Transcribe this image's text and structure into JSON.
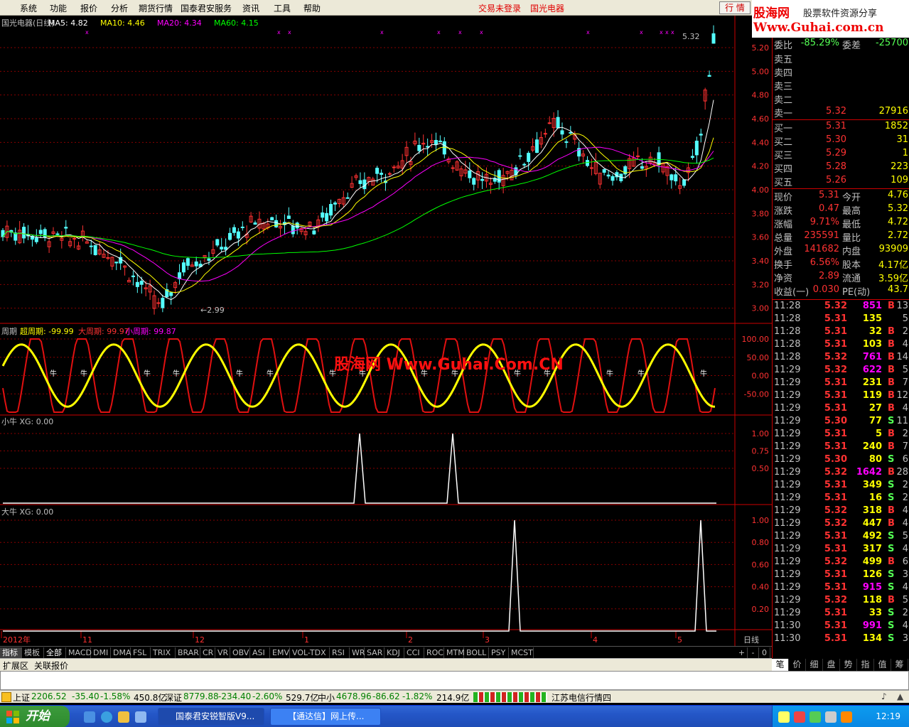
{
  "menu": {
    "items": [
      "系统",
      "功能",
      "报价",
      "分析",
      "期货行情",
      "国泰君安服务",
      "资讯",
      "工具",
      "帮助"
    ],
    "status_login": "交易未登录",
    "stock_link": "国光电器",
    "quote_button": "行 情"
  },
  "logo": {
    "top": "股海网",
    "top_sub": "股票软件资源分享",
    "bottom": "Www.Guhai.com.cn"
  },
  "chart": {
    "title": "国光电器(日线)",
    "ma5": "MA5: 4.82",
    "ma10": "MA10: 4.46",
    "ma20": "MA20: 4.34",
    "ma60": "MA60: 4.15",
    "high_label": "5.32",
    "low_label": "←2.99",
    "price_axis": [
      "5.20",
      "5.00",
      "4.80",
      "4.60",
      "4.40",
      "4.20",
      "4.00",
      "3.80",
      "3.60",
      "3.40",
      "3.20",
      "3.00"
    ],
    "cycle_title": "周期",
    "cycle_super": "超周期: -99.99",
    "cycle_big": "大周期: 99.97",
    "cycle_small": "小周期: 99.87",
    "cycle_axis": [
      "100.00",
      "50.00",
      "0.00",
      "-50.00"
    ],
    "niu_marker": "牛",
    "watermark": "股海网 Www.Guhai.Com.CN",
    "small_title": "小牛  XG: 0.00",
    "small_axis": [
      "1.00",
      "0.75",
      "0.50"
    ],
    "big_title": "大牛  XG: 0.00",
    "big_axis": [
      "1.00",
      "0.80",
      "0.60",
      "0.40",
      "0.20"
    ],
    "date_axis": [
      {
        "x": 2,
        "t": "2012年"
      },
      {
        "x": 114,
        "t": "11"
      },
      {
        "x": 272,
        "t": "12"
      },
      {
        "x": 426,
        "t": "1"
      },
      {
        "x": 572,
        "t": "2"
      },
      {
        "x": 680,
        "t": "3"
      },
      {
        "x": 832,
        "t": "4"
      },
      {
        "x": 951,
        "t": "5"
      }
    ],
    "period": "日线"
  },
  "chart_data": {
    "type": "candlestick",
    "title": "国光电器(日线)",
    "ylim": [
      2.95,
      5.35
    ],
    "high": 5.32,
    "low": 2.99,
    "ma": {
      "MA5": 4.82,
      "MA10": 4.46,
      "MA20": 4.34,
      "MA60": 4.15
    },
    "cycle": {
      "super": -99.99,
      "big": 99.97,
      "small": 99.87
    },
    "xiaoniu_xg": 0.0,
    "daniu_xg": 0.0
  },
  "panel": {
    "weibi_lbl": "委比",
    "weibi": "-85.29%",
    "weicha_lbl": "委差",
    "weicha": "-25700",
    "sells": [
      {
        "lbl": "卖五",
        "p": "",
        "v": ""
      },
      {
        "lbl": "卖四",
        "p": "",
        "v": ""
      },
      {
        "lbl": "卖三",
        "p": "",
        "v": ""
      },
      {
        "lbl": "卖二",
        "p": "",
        "v": ""
      },
      {
        "lbl": "卖一",
        "p": "5.32",
        "v": "27916"
      }
    ],
    "buys": [
      {
        "lbl": "买一",
        "p": "5.31",
        "v": "1852"
      },
      {
        "lbl": "买二",
        "p": "5.30",
        "v": "31"
      },
      {
        "lbl": "买三",
        "p": "5.29",
        "v": "1"
      },
      {
        "lbl": "买四",
        "p": "5.28",
        "v": "223"
      },
      {
        "lbl": "买五",
        "p": "5.26",
        "v": "109"
      }
    ],
    "stats": [
      {
        "l1": "现价",
        "v1": "5.31",
        "l2": "今开",
        "v2": "4.76"
      },
      {
        "l1": "涨跌",
        "v1": "0.47",
        "l2": "最高",
        "v2": "5.32"
      },
      {
        "l1": "涨幅",
        "v1": "9.71%",
        "l2": "最低",
        "v2": "4.72"
      },
      {
        "l1": "总量",
        "v1": "235591",
        "l2": "量比",
        "v2": "2.72"
      },
      {
        "l1": "外盘",
        "v1": "141682",
        "l2": "内盘",
        "v2": "93909"
      },
      {
        "l1": "换手",
        "v1": "6.56%",
        "l2": "股本",
        "v2": "4.17亿"
      },
      {
        "l1": "净资",
        "v1": "2.89",
        "l2": "流通",
        "v2": "3.59亿"
      },
      {
        "l1": "收益(一)",
        "v1": "0.030",
        "l2": "PE(动)",
        "v2": "43.7"
      }
    ],
    "ticks": [
      [
        "11:28",
        "5.32",
        "851",
        "B",
        "13"
      ],
      [
        "11:28",
        "5.31",
        "135",
        "",
        "5"
      ],
      [
        "11:28",
        "5.31",
        "32",
        "B",
        "2"
      ],
      [
        "11:28",
        "5.31",
        "103",
        "B",
        "4"
      ],
      [
        "11:28",
        "5.32",
        "761",
        "B",
        "14"
      ],
      [
        "11:29",
        "5.32",
        "622",
        "B",
        "5"
      ],
      [
        "11:29",
        "5.31",
        "231",
        "B",
        "7"
      ],
      [
        "11:29",
        "5.31",
        "119",
        "B",
        "12"
      ],
      [
        "11:29",
        "5.31",
        "27",
        "B",
        "4"
      ],
      [
        "11:29",
        "5.30",
        "77",
        "S",
        "11"
      ],
      [
        "11:29",
        "5.31",
        "5",
        "B",
        "2"
      ],
      [
        "11:29",
        "5.31",
        "240",
        "B",
        "7"
      ],
      [
        "11:29",
        "5.30",
        "80",
        "S",
        "6"
      ],
      [
        "11:29",
        "5.32",
        "1642",
        "B",
        "28"
      ],
      [
        "11:29",
        "5.31",
        "349",
        "S",
        "2"
      ],
      [
        "11:29",
        "5.31",
        "16",
        "S",
        "2"
      ],
      [
        "11:29",
        "5.32",
        "318",
        "B",
        "4"
      ],
      [
        "11:29",
        "5.32",
        "447",
        "B",
        "4"
      ],
      [
        "11:29",
        "5.31",
        "492",
        "S",
        "5"
      ],
      [
        "11:29",
        "5.31",
        "317",
        "S",
        "4"
      ],
      [
        "11:29",
        "5.32",
        "499",
        "B",
        "6"
      ],
      [
        "11:29",
        "5.31",
        "126",
        "S",
        "3"
      ],
      [
        "11:29",
        "5.31",
        "915",
        "S",
        "4"
      ],
      [
        "11:29",
        "5.32",
        "118",
        "B",
        "5"
      ],
      [
        "11:29",
        "5.31",
        "33",
        "S",
        "2"
      ],
      [
        "11:30",
        "5.31",
        "991",
        "S",
        "4"
      ],
      [
        "11:30",
        "5.31",
        "134",
        "S",
        "3"
      ]
    ]
  },
  "tabs": [
    "指标",
    "模板",
    "全部",
    "MACD",
    "DMI",
    "DMA",
    "FSL",
    "TRIX",
    "BRAR",
    "CR",
    "VR",
    "OBV",
    "ASI",
    "EMV",
    "VOL-TDX",
    "RSI",
    "WR",
    "SAR",
    "KDJ",
    "CCI",
    "ROC",
    "MTM",
    "BOLL",
    "PSY",
    "MCST"
  ],
  "tab_ctrl": [
    "+",
    "-",
    "0"
  ],
  "tabs2": [
    "扩展区",
    "关联报价"
  ],
  "rtabs": [
    "笔",
    "价",
    "细",
    "盘",
    "势",
    "指",
    "值",
    "筹"
  ],
  "status": {
    "sh_lbl": "上证",
    "sh": "2206.52",
    "sh_chg": "-35.40",
    "sh_pct": "-1.58%",
    "sh_amt": "450.8亿",
    "sz_lbl": "深证",
    "sz": "8779.88",
    "sz_chg": "-234.40",
    "sz_pct": "-2.60%",
    "sz_amt": "529.7亿",
    "zx_lbl": "中小",
    "zx": "4678.96",
    "zx_chg": "-86.62",
    "zx_pct": "-1.82%",
    "zx_amt": "214.9亿",
    "ticker": "江苏电信行情四"
  },
  "taskbar": {
    "start": "开始",
    "task1": "国泰君安锐智版V9...",
    "task2": "【通达信】网上传...",
    "clock": "12:19"
  },
  "colors": {
    "up": "#ff3232",
    "down": "#54ffff",
    "ma5": "#ffffff",
    "ma10": "#ffff00",
    "ma20": "#ff00ff",
    "ma60": "#00ff00"
  }
}
